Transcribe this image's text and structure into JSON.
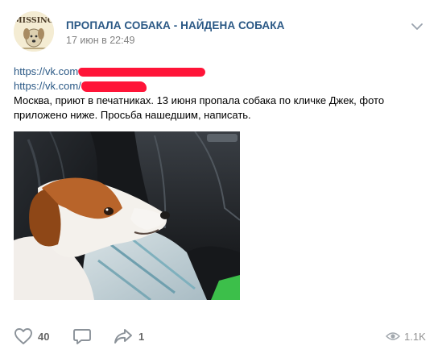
{
  "post": {
    "group_name": "ПРОПАЛА СОБАКА - НАЙДЕНА СОБАКА",
    "date": "17 июн в 22:49",
    "avatar_text": "MISSING",
    "links": [
      {
        "prefix": "https://vk.com"
      },
      {
        "prefix": "https://vk.com/"
      }
    ],
    "body": "Москва, приют в печатниках. 13 июня пропала собака по кличке Джек, фото приложено ниже. Просьба нашедшим, написать.",
    "photo_icon": "dog-photo",
    "redaction_color": "#ff1438"
  },
  "actions": {
    "likes": "40",
    "comments": "",
    "shares": "1",
    "views": "1.1K"
  },
  "icons": {
    "menu": "chevron-down-icon",
    "like": "heart-icon",
    "comment": "comment-icon",
    "share": "share-icon",
    "views": "eye-icon"
  },
  "colors": {
    "link": "#2a5885",
    "meta": "#828282",
    "action_icon": "#8b9299"
  }
}
